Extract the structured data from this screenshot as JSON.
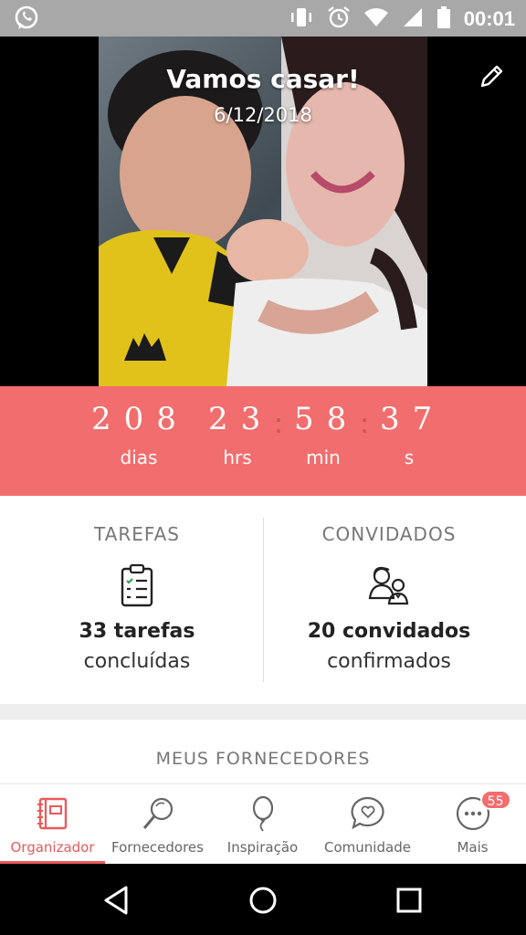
{
  "status_bar": {
    "time": "00:01",
    "icons": [
      "whatsapp-icon",
      "vibrate-icon",
      "alarm-icon",
      "wifi-icon",
      "signal-icon",
      "battery-icon"
    ]
  },
  "hero": {
    "title": "Vamos casar!",
    "date": "6/12/2018",
    "edit_icon": "pencil-icon"
  },
  "countdown": {
    "days": "208",
    "days_label": "dias",
    "hours": "23",
    "hours_label": "hrs",
    "minutes": "58",
    "minutes_label": "min",
    "seconds": "37",
    "seconds_label": "s",
    "color": "#f26d6d"
  },
  "stats": {
    "tasks": {
      "title": "TAREFAS",
      "count": "33 tarefas",
      "sub": "concluídas",
      "icon": "clipboard-icon"
    },
    "guests": {
      "title": "CONVIDADOS",
      "count": "20 convidados",
      "sub": "confirmados",
      "icon": "couple-icon"
    }
  },
  "suppliers": {
    "title": "MEUS FORNECEDORES"
  },
  "bottom_nav": {
    "active_color": "#e85a5a",
    "items": [
      {
        "label": "Organizador",
        "icon": "planner-icon",
        "active": true
      },
      {
        "label": "Fornecedores",
        "icon": "magnifier-icon",
        "active": false
      },
      {
        "label": "Inspiração",
        "icon": "balloon-icon",
        "active": false
      },
      {
        "label": "Comunidade",
        "icon": "chat-heart-icon",
        "active": false
      },
      {
        "label": "Mais",
        "icon": "more-icon",
        "active": false,
        "badge": "55"
      }
    ]
  },
  "system_nav": [
    "back-icon",
    "home-icon",
    "recents-icon"
  ]
}
